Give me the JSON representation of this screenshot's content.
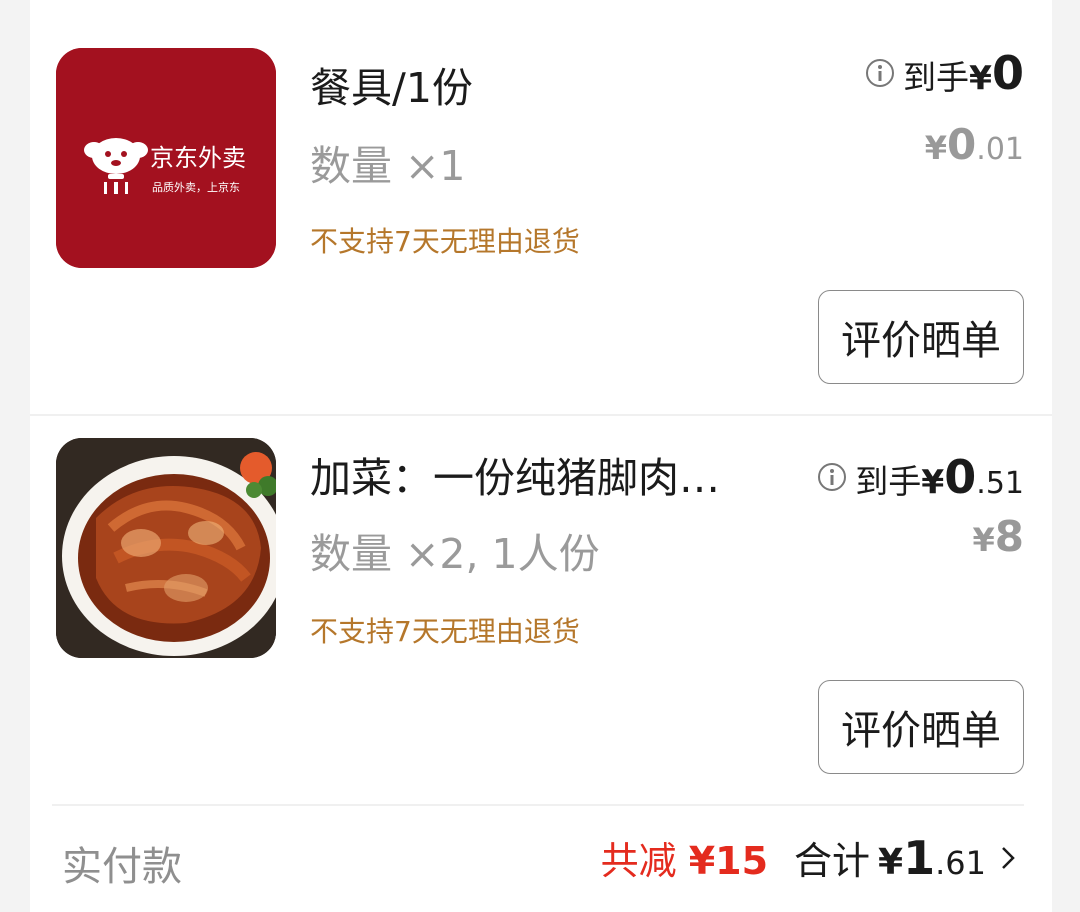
{
  "items": [
    {
      "title": "餐具/1份",
      "quantity": "数量 ×1",
      "no_refund": "不支持7天无理由退货",
      "net_label": "到手",
      "net_currency": "¥",
      "net_int": "0",
      "net_dec": "",
      "orig_currency": "¥",
      "orig_int": "0",
      "orig_dec": ".01",
      "review_label": "评价晒单",
      "thumb": {
        "icon": "jd-waimai-logo",
        "brand": "京东外卖",
        "slogan": "品质外卖，上京东",
        "bg_color": "#a3111f"
      }
    },
    {
      "title": "加菜：一份纯猪脚肉…",
      "quantity": "数量 ×2, 1人份",
      "no_refund": "不支持7天无理由退货",
      "net_label": "到手",
      "net_currency": "¥",
      "net_int": "0",
      "net_dec": ".51",
      "orig_currency": "¥",
      "orig_int": "8",
      "orig_dec": "",
      "review_label": "评价晒单",
      "thumb": {
        "icon": "braised-pork-trotter-photo"
      }
    }
  ],
  "footer": {
    "paid_label": "实付款",
    "discount_label": "共减",
    "discount_amount": "¥15",
    "total_label": "合计",
    "total_currency": "¥",
    "total_int": "1",
    "total_dec": ".61",
    "chevron_icon": "chevron-right-icon"
  },
  "colors": {
    "discount": "#e42b1e",
    "no_refund": "#b5772b",
    "brand_red": "#a3111f"
  }
}
